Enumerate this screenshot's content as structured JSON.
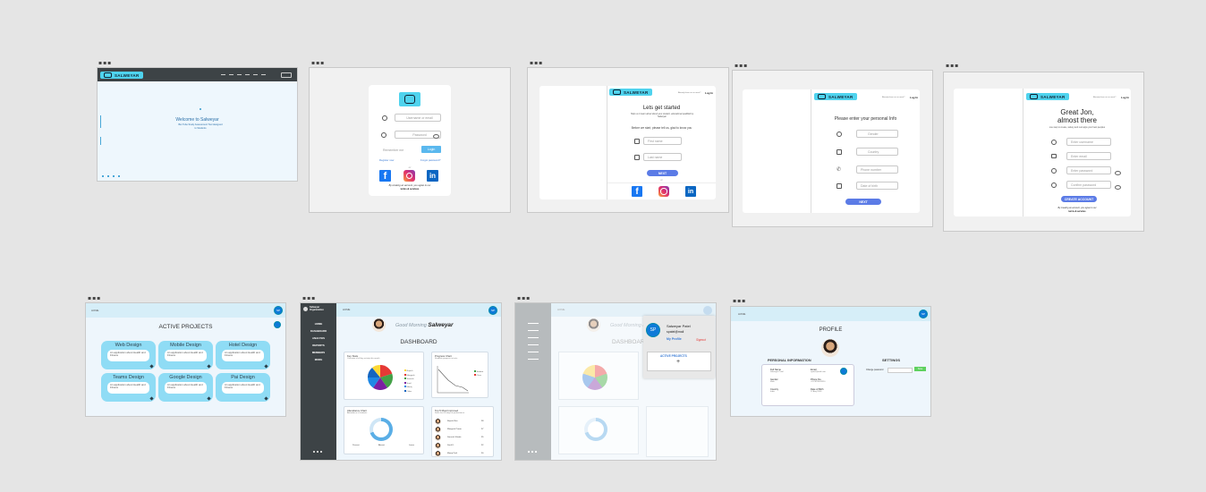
{
  "frames": {
    "landing": {
      "tag": "▪▪▪",
      "brand": "SALWEYAR",
      "hero_title": "Welcome to Salweyar",
      "hero_sub": "Bet Tube Study Assessment Tool designed to Students"
    },
    "login": {
      "tag": "▪▪▪",
      "username_placeholder": "Username or email",
      "password_placeholder": "Password",
      "remember_label": "Remember me",
      "login_label": "Login",
      "register_link": "Register now",
      "forgot_link": "Forgot password?",
      "or": "or",
      "legal": "By creating an account, you agree to our",
      "legal_link": "terms & services"
    },
    "signup": {
      "tag": "▪▪▪",
      "brand": "SALWEYAR",
      "header_links": "Already have an account?",
      "header_login": "Log In",
      "title": "Lets get started",
      "sub": "Help us to learn about about your student, educational qualified by Salweyar",
      "prompt": "Before we start, please tell us, glad to know you",
      "first_name": "First name",
      "last_name": "Last name",
      "next": "NEXT",
      "or": "or"
    },
    "personal": {
      "tag": "▪▪▪",
      "brand": "SALWEYAR",
      "header_links": "Already have an account?",
      "header_login": "Log In",
      "title": "Please enter your personal Info",
      "gender": "Gender",
      "country": "Country",
      "phone": "Phone number",
      "dob": "Date of birth",
      "next": "NEXT"
    },
    "account": {
      "tag": "▪▪▪",
      "brand": "SALWEYAR",
      "header_links": "Already have an account?",
      "header_login": "Log In",
      "title": "Great Jon,",
      "title2": "almost there",
      "sub": "one step to create, variety and rest apps your best peoples",
      "username": "Enter username",
      "email": "Enter email",
      "password": "Enter password",
      "confirm": "Confirm password",
      "submit": "CREATE ACCOUNT",
      "legal": "By creating an account, you agree to our",
      "legal_link": "terms & services"
    },
    "projects": {
      "tag": "▪▪▪",
      "crumb": "HOME",
      "avatar": "SP",
      "title": "ACTIVE PROJECTS",
      "desc": "An application about Health and Fitness",
      "items": [
        "Web Design",
        "Mobile Design",
        "Hotel Design",
        "Teams Design",
        "Google Design",
        "Pai Design"
      ]
    },
    "dashboard": {
      "tag": "▪▪▪",
      "brand_line1": "Salweyar",
      "brand_line2": "Organization",
      "crumb": "HOME",
      "avatar": "SP",
      "nav": [
        "HOME",
        "DASHBOARD",
        "ANALYSIS",
        "REPORTS",
        "MEMBERS",
        "MORE"
      ],
      "greeting": "Good Morning",
      "greeting_name": "Salweyar",
      "title": "DASHBOARD",
      "pie_title": "Key Stats",
      "pie_sub": "Overview of all key activity this month",
      "pie_legend": [
        "Rajesh",
        "Mangesh",
        "Sarvesh",
        "Sunil",
        "Manoj",
        "Other"
      ],
      "line_title": "Progress Chart",
      "line_sub": "Students progress in tests",
      "line_legend": [
        "Student",
        "Class"
      ],
      "donut_title": "Attendance Chart",
      "donut_sub": "Attendance of students",
      "donut_labels": [
        "Present",
        "Absent",
        "Leave"
      ],
      "top_title": "Top 5 Most Improved",
      "top_sub": "Since last 30 days of performance",
      "top": [
        "Rajesh Rao",
        "Mangesh Pawar",
        "Sarvesh Shinde",
        "Sunil K.",
        "Manoj Patil"
      ],
      "top_vals": [
        "98",
        "97",
        "95",
        "92",
        "90"
      ]
    },
    "dashboard_popup": {
      "tag": "▪▪▪",
      "crumb": "HOME",
      "greeting": "Good Morning",
      "greeting_name": "Sa",
      "title": "DASHBOARD",
      "popup_avatar": "SP",
      "popup_name": "Salweyar Patel",
      "popup_email": "spatel@mail",
      "popup_profile": "My Profile",
      "popup_signout": "Signout",
      "popup_projects": "ACTIVE PROJECTS",
      "popup_plus": "+"
    },
    "profile": {
      "tag": "▪▪▪",
      "crumb": "HOME",
      "avatar": "SP",
      "title": "PROFILE",
      "personal_title": "PERSONAL INFORMATION",
      "fields": [
        {
          "k": "Full Name",
          "v": "Salweyar Patel"
        },
        {
          "k": "Email",
          "v": "spatel@mail.com"
        },
        {
          "k": "Gender",
          "v": "Male"
        },
        {
          "k": "Phone No.",
          "v": "+91 9876543210"
        },
        {
          "k": "Country",
          "v": "India"
        },
        {
          "k": "Date of Birth",
          "v": "12 Aug 2000"
        }
      ],
      "settings_title": "SETTINGS",
      "settings_label": "Change password",
      "settings_btn": "Save"
    }
  },
  "colors": {
    "canvas": "#e5e5e5",
    "accent_cyan": "#4fd3ee",
    "primary_blue": "#5b7be6",
    "dark_header": "#3d4346",
    "light_panel": "#eef6fc"
  }
}
